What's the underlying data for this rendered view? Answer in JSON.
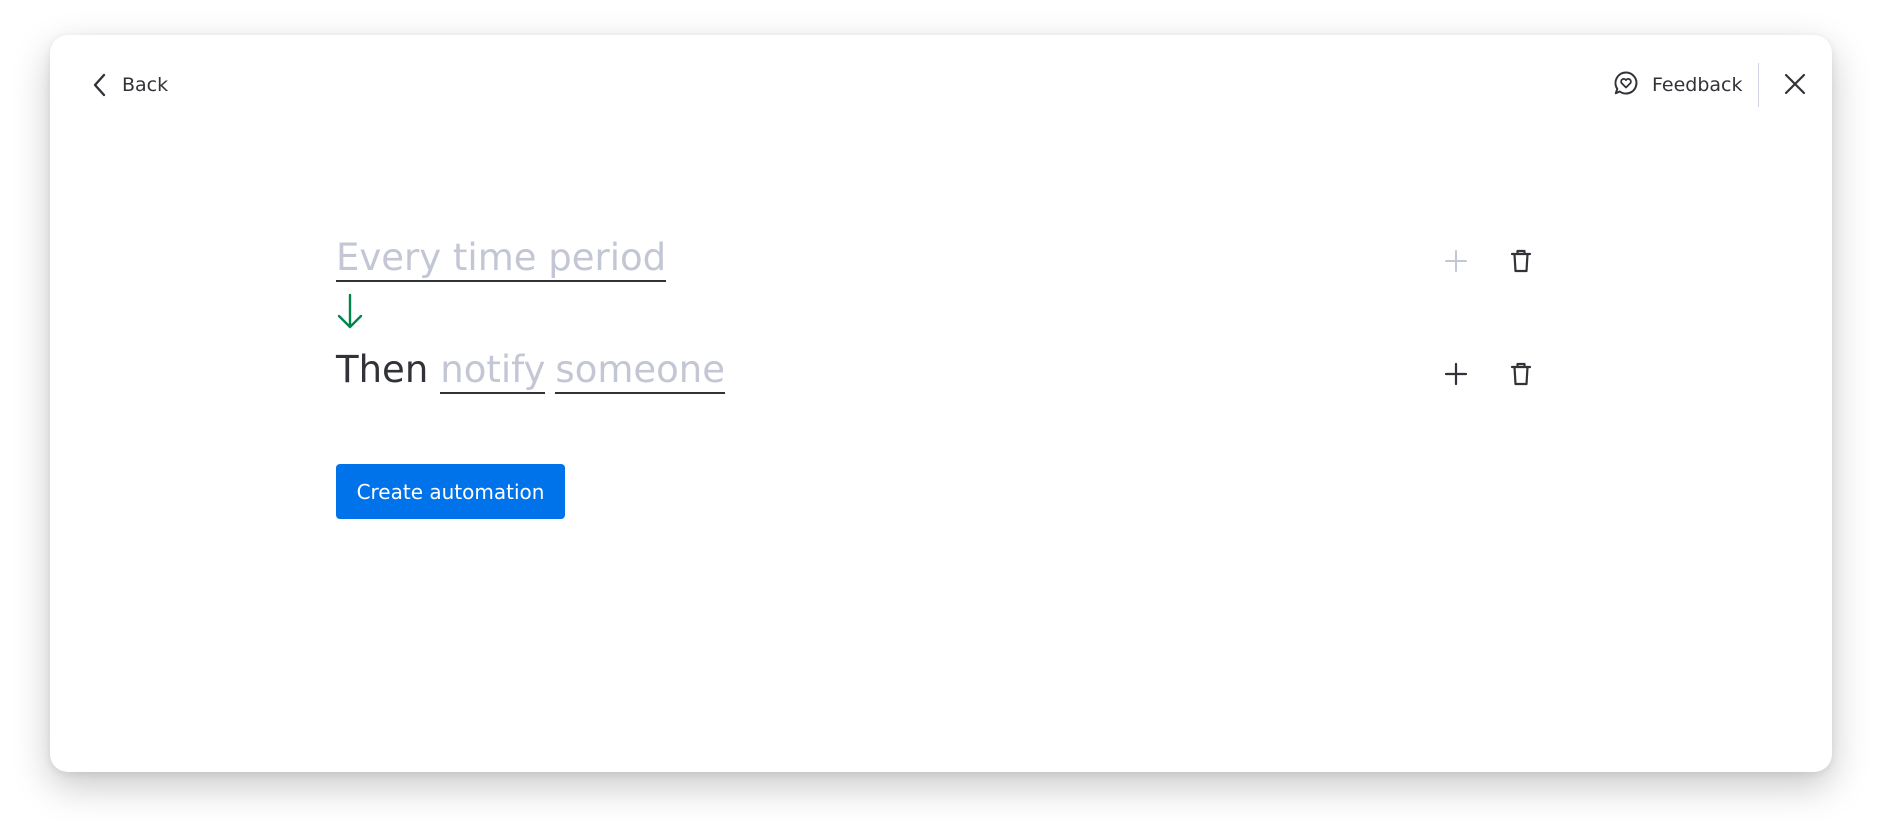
{
  "header": {
    "back_label": "Back",
    "feedback_label": "Feedback"
  },
  "recipe": {
    "trigger": {
      "tokens": [
        "Every time period"
      ],
      "plus_enabled": false
    },
    "action": {
      "prefix": "Then",
      "tokens": [
        "notify",
        "someone"
      ],
      "plus_enabled": true
    }
  },
  "footer": {
    "create_label": "Create automation"
  },
  "colors": {
    "primary": "#0073ea",
    "arrow": "#00854d",
    "placeholder": "#c3c6d4",
    "text": "#323338",
    "disabled_icon": "#c3c6d4"
  },
  "icons": {
    "back": "chevron-left-icon",
    "feedback": "chat-heart-icon",
    "close": "close-icon",
    "flow": "arrow-down-icon",
    "add": "plus-icon",
    "delete": "trash-icon"
  }
}
